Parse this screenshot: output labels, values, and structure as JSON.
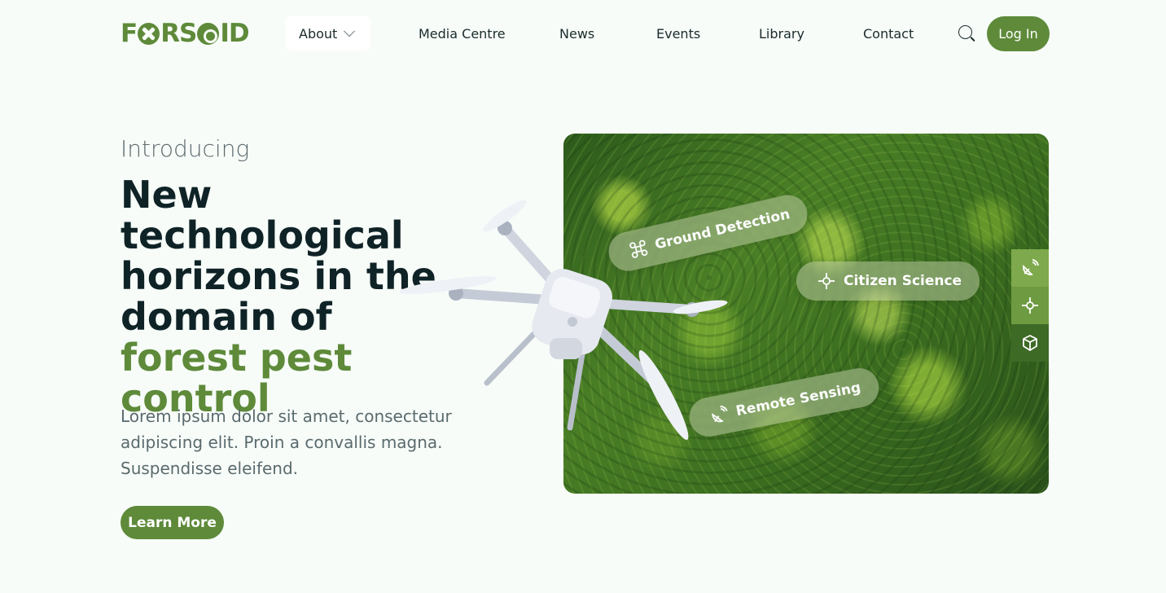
{
  "header": {
    "logo_text_1": "F",
    "logo_text_2": "RS",
    "logo_text_3": "ID",
    "nav": {
      "about": "About",
      "media": "Media Centre",
      "news": "News",
      "events": "Events",
      "library": "Library",
      "contact": "Contact"
    },
    "login_label": "Log In"
  },
  "hero": {
    "intro": "Introducing",
    "headline_plain": "New technological horizons in the domain of",
    "headline_highlight": "forest pest control",
    "description": "Lorem ipsum dolor sit amet, consectetur adipiscing elit. Proin a convallis magna. Suspendisse eleifend.",
    "cta_label": "Learn More"
  },
  "image_panel": {
    "chips": {
      "ground": "Ground Detection",
      "citizen": "Citizen Science",
      "remote": "Remote Sensing"
    },
    "side_tabs": [
      "satellite-icon",
      "drone-crosshair-icon",
      "box-icon"
    ]
  },
  "colors": {
    "brand_green": "#5e8a3a",
    "dark_text": "#0f2327",
    "background": "#f7fcf8"
  }
}
